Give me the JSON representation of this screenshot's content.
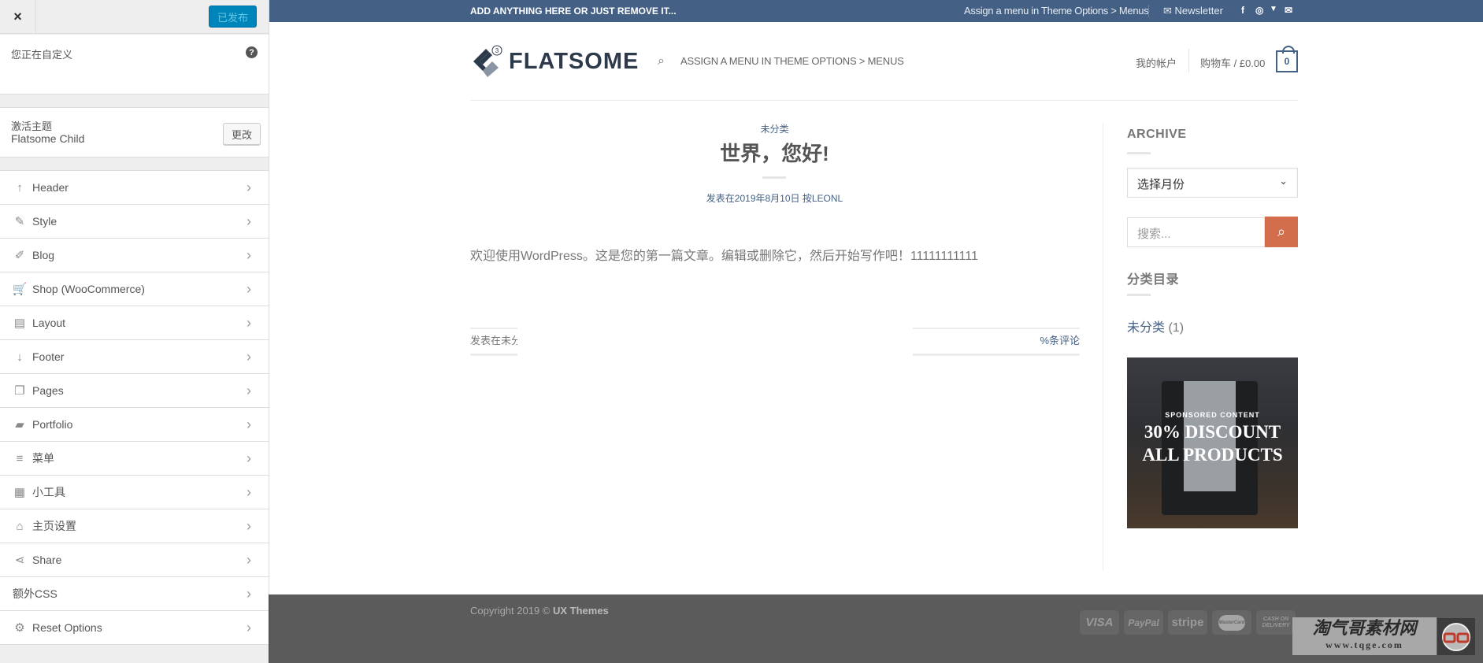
{
  "customizer": {
    "close_label": "×",
    "publish_label": "已发布",
    "customizing_label": "您正在自定义",
    "help_label": "?",
    "active_theme_label": "激活主题",
    "active_theme_name": "Flatsome Child",
    "change_label": "更改",
    "items": [
      {
        "label": "Header",
        "icon": "arrow-up-icon",
        "glyph": "↑"
      },
      {
        "label": "Style",
        "icon": "paintbrush-icon",
        "glyph": "✎"
      },
      {
        "label": "Blog",
        "icon": "pencil-icon",
        "glyph": "✐"
      },
      {
        "label": "Shop (WooCommerce)",
        "icon": "cart-icon",
        "glyph": "🛒"
      },
      {
        "label": "Layout",
        "icon": "layout-icon",
        "glyph": "▤"
      },
      {
        "label": "Footer",
        "icon": "arrow-down-icon",
        "glyph": "↓"
      },
      {
        "label": "Pages",
        "icon": "pages-icon",
        "glyph": "❐"
      },
      {
        "label": "Portfolio",
        "icon": "folder-icon",
        "glyph": "▰"
      },
      {
        "label": "菜单",
        "icon": "menu-icon",
        "glyph": "≡"
      },
      {
        "label": "小工具",
        "icon": "widgets-icon",
        "glyph": "▦"
      },
      {
        "label": "主页设置",
        "icon": "home-icon",
        "glyph": "⌂"
      },
      {
        "label": "Share",
        "icon": "share-icon",
        "glyph": "⋖"
      },
      {
        "label": "额外CSS",
        "icon": "",
        "glyph": ""
      },
      {
        "label": "Reset Options",
        "icon": "gear-icon",
        "glyph": "⚙"
      }
    ],
    "chevron": "›"
  },
  "site": {
    "topbar": {
      "left_text": "ADD ANYTHING HERE OR JUST REMOVE IT...",
      "menu_text": "Assign a menu in Theme Options > Menus",
      "newsletter_label": "Newsletter",
      "social": [
        {
          "name": "facebook-icon",
          "glyph": "f"
        },
        {
          "name": "instagram-icon",
          "glyph": "◎"
        },
        {
          "name": "twitter-icon",
          "glyph": "🐦"
        },
        {
          "name": "email-icon",
          "glyph": "✉"
        }
      ],
      "colors": {
        "bar": "#446084"
      }
    },
    "header": {
      "logo_text": "FLATSOME",
      "logo_badge": "3",
      "nav_text": "ASSIGN A MENU IN THEME OPTIONS > MENUS",
      "account_label": "我的帐户",
      "cart_label": "购物车 / £0.00",
      "cart_count": "0"
    },
    "post": {
      "category": "未分类",
      "title": "世界，您好!",
      "meta": "发表在2019年8月10日 按LEONL",
      "body": "欢迎使用WordPress。这是您的第一篇文章。编辑或删除它，然后开始写作吧！11111111111",
      "footer_left": "发表在未分类",
      "footer_right": "%条评论"
    },
    "sidebar": {
      "archive_title": "ARCHIVE",
      "archive_select": "选择月份",
      "search_placeholder": "搜索...",
      "categories_title": "分类目录",
      "category_link": "未分类",
      "category_count": "(1)",
      "promo": {
        "kicker": "SPONSORED CONTENT",
        "line1": "30% DISCOUNT",
        "line2": "ALL PRODUCTS"
      },
      "colors": {
        "search_button": "#d26e4b",
        "link": "#446084"
      }
    },
    "footer": {
      "copyright": "Copyright 2019 ©",
      "copyright_owner": "UX Themes",
      "payments": [
        "VISA",
        "PayPal",
        "stripe",
        "MasterCard",
        "CASH ON DELIVERY"
      ]
    },
    "watermark": {
      "title": "淘气哥素材网",
      "url": "www.tqge.com"
    }
  }
}
